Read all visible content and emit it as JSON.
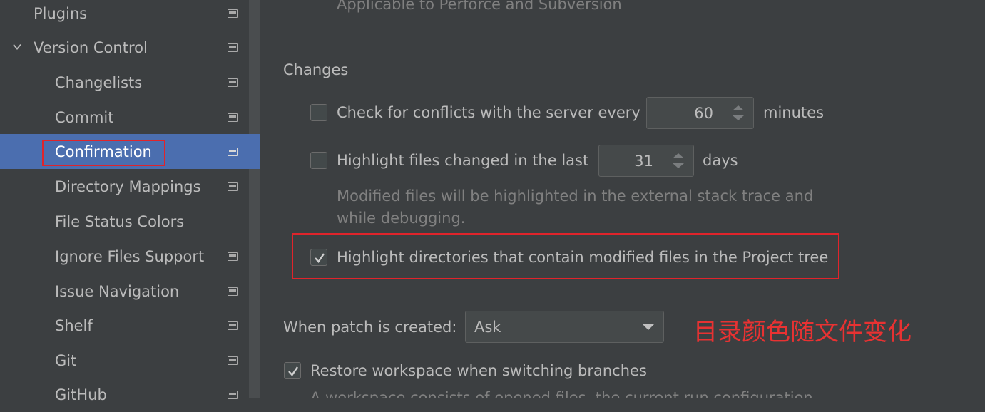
{
  "sidebar": {
    "items": [
      {
        "label": "Plugins"
      },
      {
        "label": "Version Control"
      },
      {
        "label": "Changelists"
      },
      {
        "label": "Commit"
      },
      {
        "label": "Confirmation"
      },
      {
        "label": "Directory Mappings"
      },
      {
        "label": "File Status Colors"
      },
      {
        "label": "Ignore Files Support"
      },
      {
        "label": "Issue Navigation"
      },
      {
        "label": "Shelf"
      },
      {
        "label": "Git"
      },
      {
        "label": "GitHub"
      }
    ],
    "selected": "Confirmation"
  },
  "main": {
    "top_hint": "Applicable to Perforce and Subversion",
    "changes_section_title": "Changes",
    "check_conflicts": {
      "label": "Check for conflicts with the server every",
      "value": "60",
      "unit": "minutes",
      "checked": false
    },
    "highlight_changed": {
      "label": "Highlight files changed in the last",
      "value": "31",
      "unit": "days",
      "checked": false
    },
    "modified_hint_line1": "Modified files will be highlighted in the external stack trace and",
    "modified_hint_line2": "while debugging.",
    "highlight_dirs": {
      "label": "Highlight directories that contain modified files in the Project tree",
      "checked": true
    },
    "patch": {
      "label": "When patch is created:",
      "selected": "Ask"
    },
    "annotation": "目录颜色随文件变化",
    "restore_workspace": {
      "label": "Restore workspace when switching branches",
      "checked": true
    },
    "bottom_cut_text": "A workspace consists of opened files, the current run configuration"
  },
  "colors": {
    "background": "#3c3f41",
    "selection": "#4b6eaf",
    "highlight_box": "#e0242b",
    "annotation": "#e83232"
  }
}
